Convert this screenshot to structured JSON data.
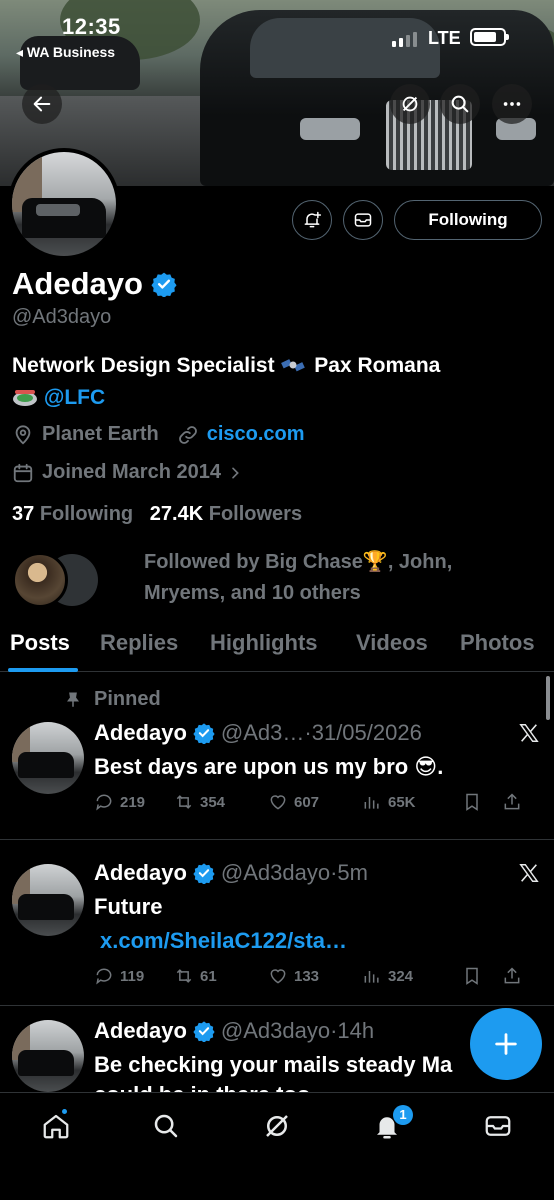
{
  "status_bar": {
    "time": "12:35",
    "back_app": "◂ WA Business",
    "network": "LTE"
  },
  "profile": {
    "name": "Adedayo",
    "handle": "@Ad3dayo",
    "bio_text": "Network Design Specialist",
    "bio_after_emoji": "Pax Romana",
    "bio_link": "@LFC",
    "location": "Planet Earth",
    "website": "cisco.com",
    "joined": "Joined March 2014",
    "following_count": "37",
    "following_label": "Following",
    "followers_count": "27.4K",
    "followers_label": "Followers",
    "followed_by": "Followed by Big Chase🏆, John, Mryems, and 10 others"
  },
  "buttons": {
    "follow_state": "Following"
  },
  "tabs": [
    {
      "label": "Posts",
      "active": true
    },
    {
      "label": "Replies",
      "active": false
    },
    {
      "label": "Highlights",
      "active": false
    },
    {
      "label": "Videos",
      "active": false
    },
    {
      "label": "Photos",
      "active": false
    }
  ],
  "pinned_label": "Pinned",
  "posts": [
    {
      "name": "Adedayo",
      "handle_time": "@Ad3…·31/05/2026",
      "text": "Best days are upon us my bro 😎.",
      "link": "",
      "replies": "219",
      "reposts": "354",
      "likes": "607",
      "views": "65K"
    },
    {
      "name": "Adedayo",
      "handle_time": "@Ad3dayo·5m",
      "text": "Future",
      "link": "x.com/SheilaC122/sta…",
      "replies": "119",
      "reposts": "61",
      "likes": "133",
      "views": "324"
    },
    {
      "name": "Adedayo",
      "handle_time": "@Ad3dayo·14h",
      "text": "Be checking your mails steady Ma",
      "text2": "could be in there too"
    }
  ],
  "notifications_badge": "1",
  "colors": {
    "accent": "#1d9bf0",
    "muted": "#71767b",
    "background": "#000000",
    "border": "#2f3336"
  }
}
